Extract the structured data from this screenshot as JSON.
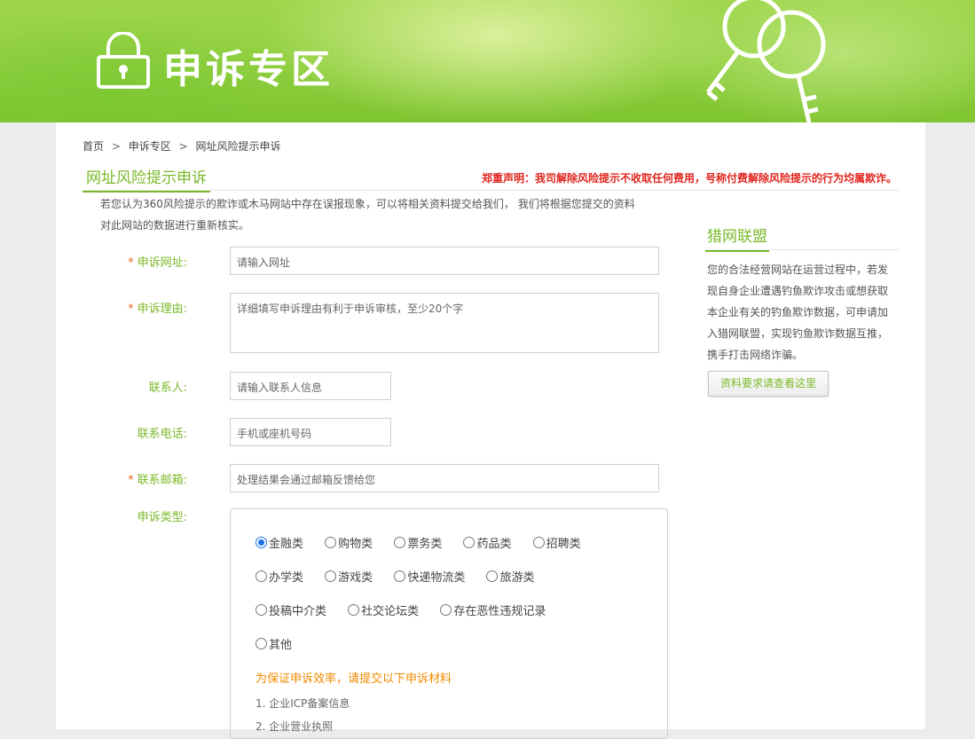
{
  "banner": {
    "title": "申诉专区"
  },
  "breadcrumb": [
    {
      "label": "首页"
    },
    {
      "label": "申诉专区"
    },
    {
      "label": "网址风险提示申诉"
    }
  ],
  "breadcrumb_sep": ">",
  "section": {
    "title": "网址风险提示申诉"
  },
  "declaration": "郑重声明：我司解除风险提示不收取任何费用，号称付费解除风险提示的行为均属欺诈。",
  "intro": {
    "line1": "若您认为360风险提示的欺诈或木马网站中存在误报现象，可以将相关资料提交给我们， 我们将根据您提交的资料",
    "line2": "对此网站的数据进行重新核实。"
  },
  "form": {
    "url": {
      "required": "*",
      "label": "申诉网址:",
      "placeholder": "请输入网址"
    },
    "reason": {
      "required": "*",
      "label": "申诉理由:",
      "placeholder": "详细填写申诉理由有利于申诉审核，至少20个字"
    },
    "contact": {
      "label": "联系人:",
      "placeholder": "请输入联系人信息"
    },
    "phone": {
      "label": "联系电话:",
      "placeholder": "手机或座机号码"
    },
    "email": {
      "required": "*",
      "label": "联系邮箱:",
      "placeholder": "处理结果会通过邮箱反馈给您"
    },
    "type": {
      "label": "申诉类型:",
      "row1": [
        "金融类",
        "购物类",
        "票务类",
        "药品类",
        "招聘类"
      ],
      "row2": [
        "办学类",
        "游戏类",
        "快递物流类",
        "旅游类"
      ],
      "row3": [
        "投稿中介类",
        "社交论坛类",
        "存在恶性违规记录"
      ],
      "row4": [
        "其他"
      ],
      "selected": "金融类"
    },
    "materials": {
      "title": "为保证申诉效率，请提交以下申诉材料",
      "items": [
        "1. 企业ICP备案信息",
        "2. 企业营业执照"
      ]
    }
  },
  "sidebar": {
    "title": "猎网联盟",
    "text": "您的合法经营网站在运营过程中，若发现自身企业遭遇钓鱼欺诈攻击或想获取本企业有关的钓鱼欺诈数据，可申请加入猎网联盟，实现钓鱼欺诈数据互推，携手打击网络诈骗。",
    "button": "资料要求请查看这里"
  },
  "colors": {
    "accent": "#7ab929",
    "warning": "#e0251f",
    "orange": "#f08a00",
    "radio": "#1a73e8"
  }
}
